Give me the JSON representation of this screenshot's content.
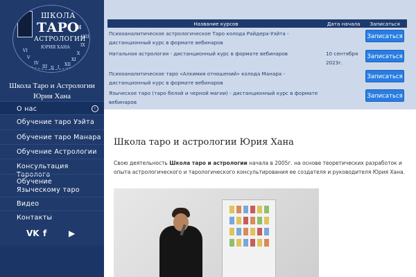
{
  "colors": {
    "sidebar": "#1f3a6b",
    "accent_button": "#2a7de1",
    "table_header": "#1d3a6d",
    "top_band": "#cdd9ea"
  },
  "logo": {
    "line1": "ШКОЛА",
    "line2": "ТАРО",
    "line2_suffix": "и",
    "line3": "АСТРОЛОГИИ",
    "line4": "ЮРИЯ ХАНА",
    "numerals": [
      "VI",
      "V",
      "IV",
      "III",
      "II",
      "I",
      "XII",
      "XI",
      "X",
      "IX",
      "VIII"
    ]
  },
  "sidebar": {
    "site_name_line1": "Школа Таро и Астрологии",
    "site_name_line2": "Юрия Хана",
    "nav": [
      {
        "label": "О нас",
        "expand_icon": "chevron-circle-icon"
      },
      {
        "label": "Обучение таро Уэйта"
      },
      {
        "label": "Обучение таро Манара"
      },
      {
        "label": "Обучение Астрологии"
      },
      {
        "label": "Консультация Таролога"
      },
      {
        "label": "Обучение Языческому таро"
      },
      {
        "label": "Видео"
      },
      {
        "label": "Контакты"
      }
    ],
    "social": [
      {
        "label": "VK",
        "icon": "vk-icon"
      },
      {
        "label": "f",
        "icon": "facebook-icon"
      },
      {
        "label": "▶",
        "icon": "youtube-icon"
      }
    ]
  },
  "courses_table": {
    "headers": [
      "Название курсов",
      "Дата начала",
      "Записаться"
    ],
    "rows": [
      {
        "name": "Психоаналитическое астрологическое Таро колода Райдера-Уэйта - дистанционный курс в формате вебинаров",
        "date": "",
        "button": "Записаться"
      },
      {
        "name": "Натальная астрология - дистанционный курс в формате вебинаров",
        "date": "10 сентября 2023г.",
        "button": "Записаться"
      },
      {
        "name": "Психоаналитическое таро «Алхимия отношений» колода Манара - дистанционный курс в формате вебинаров",
        "date": "",
        "button": "Записаться"
      },
      {
        "name": "Языческое таро (таро белой и черной магии) - дистанционный курс в формате вебинаров",
        "date": "",
        "button": "Записаться"
      }
    ]
  },
  "main": {
    "title": "Школа таро и астрологии Юрия Хана",
    "intro_prefix": "Свою деятельность ",
    "intro_bold": "Школа таро и астрологии",
    "intro_rest": " начала в 2005г. на основе теоретических разработок и опыта астрологического и тарологического консультирования ее создателя и руководителя Юрия Хана."
  }
}
